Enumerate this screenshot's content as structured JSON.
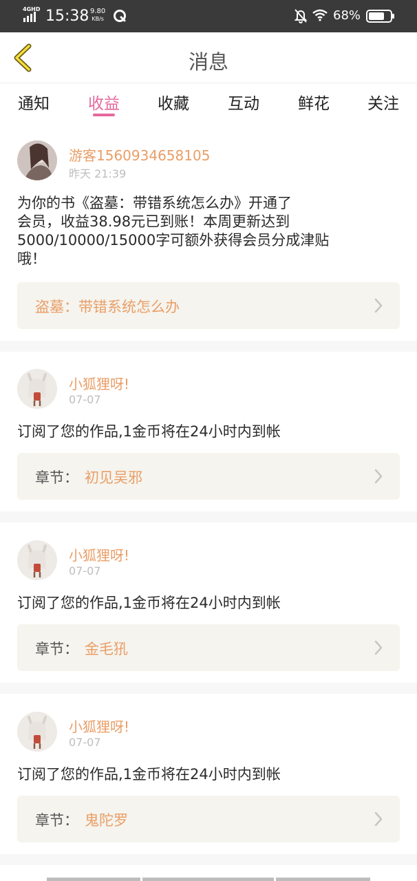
{
  "status_bar": {
    "network": "4GHD",
    "time": "15:38",
    "speed_value": "9.80",
    "speed_unit": "KB/s",
    "battery": "68%"
  },
  "header": {
    "title": "消息",
    "back_icon": "chevron-left-icon"
  },
  "tabs": [
    {
      "label": "通知",
      "active": false
    },
    {
      "label": "收益",
      "active": true
    },
    {
      "label": "收藏",
      "active": false
    },
    {
      "label": "互动",
      "active": false
    },
    {
      "label": "鲜花",
      "active": false
    },
    {
      "label": "关注",
      "active": false
    }
  ],
  "colors": {
    "accent": "#e5689d",
    "name": "#ea9e67",
    "box": "#f5f4ee"
  },
  "messages": [
    {
      "user": "游客1560934658105",
      "date": "昨天 21:39",
      "text_lines": [
        "为你的书《盗墓：带错系统怎么办》开通了",
        "会员，收益38.98元已到账！本周更新达到",
        "5000/10000/15000字可额外获得会员分成津贴",
        "哦！"
      ],
      "link_prefix": "",
      "link_title": "盗墓：带错系统怎么办"
    },
    {
      "user": "小狐狸呀!",
      "date": "07-07",
      "text_lines": [
        "订阅了您的作品,1金币将在24小时内到帐"
      ],
      "link_prefix": "章节：",
      "link_title": "初见吴邪"
    },
    {
      "user": "小狐狸呀!",
      "date": "07-07",
      "text_lines": [
        "订阅了您的作品,1金币将在24小时内到帐"
      ],
      "link_prefix": "章节：",
      "link_title": "金毛犼"
    },
    {
      "user": "小狐狸呀!",
      "date": "07-07",
      "text_lines": [
        "订阅了您的作品,1金币将在24小时内到帐"
      ],
      "link_prefix": "章节：",
      "link_title": "鬼陀罗"
    }
  ]
}
